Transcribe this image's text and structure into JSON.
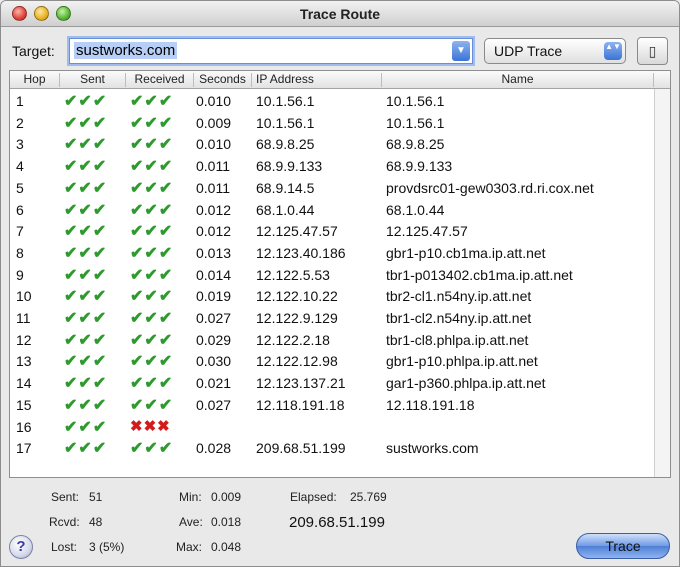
{
  "window": {
    "title": "Trace Route"
  },
  "toolbar": {
    "target_label": "Target:",
    "target_value": "sustworks.com",
    "trace_type": "UDP Trace",
    "combo_arrow": "▼",
    "popup_arrows": "▲▼",
    "extra_button": "▯"
  },
  "table": {
    "columns": {
      "hop": "Hop",
      "sent": "Sent",
      "received": "Received",
      "seconds": "Seconds",
      "ip": "IP Address",
      "name": "Name"
    },
    "rows": [
      {
        "hop": "1",
        "sent": "✔✔✔",
        "received": "✔✔✔",
        "seconds": "0.010",
        "ip": "10.1.56.1",
        "name": "10.1.56.1"
      },
      {
        "hop": "2",
        "sent": "✔✔✔",
        "received": "✔✔✔",
        "seconds": "0.009",
        "ip": "10.1.56.1",
        "name": "10.1.56.1"
      },
      {
        "hop": "3",
        "sent": "✔✔✔",
        "received": "✔✔✔",
        "seconds": "0.010",
        "ip": "68.9.8.25",
        "name": "68.9.8.25"
      },
      {
        "hop": "4",
        "sent": "✔✔✔",
        "received": "✔✔✔",
        "seconds": "0.011",
        "ip": "68.9.9.133",
        "name": "68.9.9.133"
      },
      {
        "hop": "5",
        "sent": "✔✔✔",
        "received": "✔✔✔",
        "seconds": "0.011",
        "ip": "68.9.14.5",
        "name": "provdsrc01-gew0303.rd.ri.cox.net"
      },
      {
        "hop": "6",
        "sent": "✔✔✔",
        "received": "✔✔✔",
        "seconds": "0.012",
        "ip": "68.1.0.44",
        "name": "68.1.0.44"
      },
      {
        "hop": "7",
        "sent": "✔✔✔",
        "received": "✔✔✔",
        "seconds": "0.012",
        "ip": "12.125.47.57",
        "name": "12.125.47.57"
      },
      {
        "hop": "8",
        "sent": "✔✔✔",
        "received": "✔✔✔",
        "seconds": "0.013",
        "ip": "12.123.40.186",
        "name": "gbr1-p10.cb1ma.ip.att.net"
      },
      {
        "hop": "9",
        "sent": "✔✔✔",
        "received": "✔✔✔",
        "seconds": "0.014",
        "ip": "12.122.5.53",
        "name": "tbr1-p013402.cb1ma.ip.att.net"
      },
      {
        "hop": "10",
        "sent": "✔✔✔",
        "received": "✔✔✔",
        "seconds": "0.019",
        "ip": "12.122.10.22",
        "name": "tbr2-cl1.n54ny.ip.att.net"
      },
      {
        "hop": "11",
        "sent": "✔✔✔",
        "received": "✔✔✔",
        "seconds": "0.027",
        "ip": "12.122.9.129",
        "name": "tbr1-cl2.n54ny.ip.att.net"
      },
      {
        "hop": "12",
        "sent": "✔✔✔",
        "received": "✔✔✔",
        "seconds": "0.029",
        "ip": "12.122.2.18",
        "name": "tbr1-cl8.phlpa.ip.att.net"
      },
      {
        "hop": "13",
        "sent": "✔✔✔",
        "received": "✔✔✔",
        "seconds": "0.030",
        "ip": "12.122.12.98",
        "name": "gbr1-p10.phlpa.ip.att.net"
      },
      {
        "hop": "14",
        "sent": "✔✔✔",
        "received": "✔✔✔",
        "seconds": "0.021",
        "ip": "12.123.137.21",
        "name": "gar1-p360.phlpa.ip.att.net"
      },
      {
        "hop": "15",
        "sent": "✔✔✔",
        "received": "✔✔✔",
        "seconds": "0.027",
        "ip": "12.118.191.18",
        "name": "12.118.191.18"
      },
      {
        "hop": "16",
        "sent": "✔✔✔",
        "received": "✖✖✖",
        "seconds": "",
        "ip": "",
        "name": ""
      },
      {
        "hop": "17",
        "sent": "✔✔✔",
        "received": "✔✔✔",
        "seconds": "0.028",
        "ip": "209.68.51.199",
        "name": "sustworks.com"
      }
    ]
  },
  "stats": {
    "sent_label": "Sent:",
    "sent_value": "51",
    "rcvd_label": "Rcvd:",
    "rcvd_value": "48",
    "lost_label": "Lost:",
    "lost_value": "3 (5%)",
    "min_label": "Min:",
    "min_value": "0.009",
    "ave_label": "Ave:",
    "ave_value": "0.018",
    "max_label": "Max:",
    "max_value": "0.048",
    "elapsed_label": "Elapsed:",
    "elapsed_value": "25.769",
    "destination_ip": "209.68.51.199"
  },
  "footer": {
    "help_label": "?",
    "trace_button": "Trace"
  }
}
